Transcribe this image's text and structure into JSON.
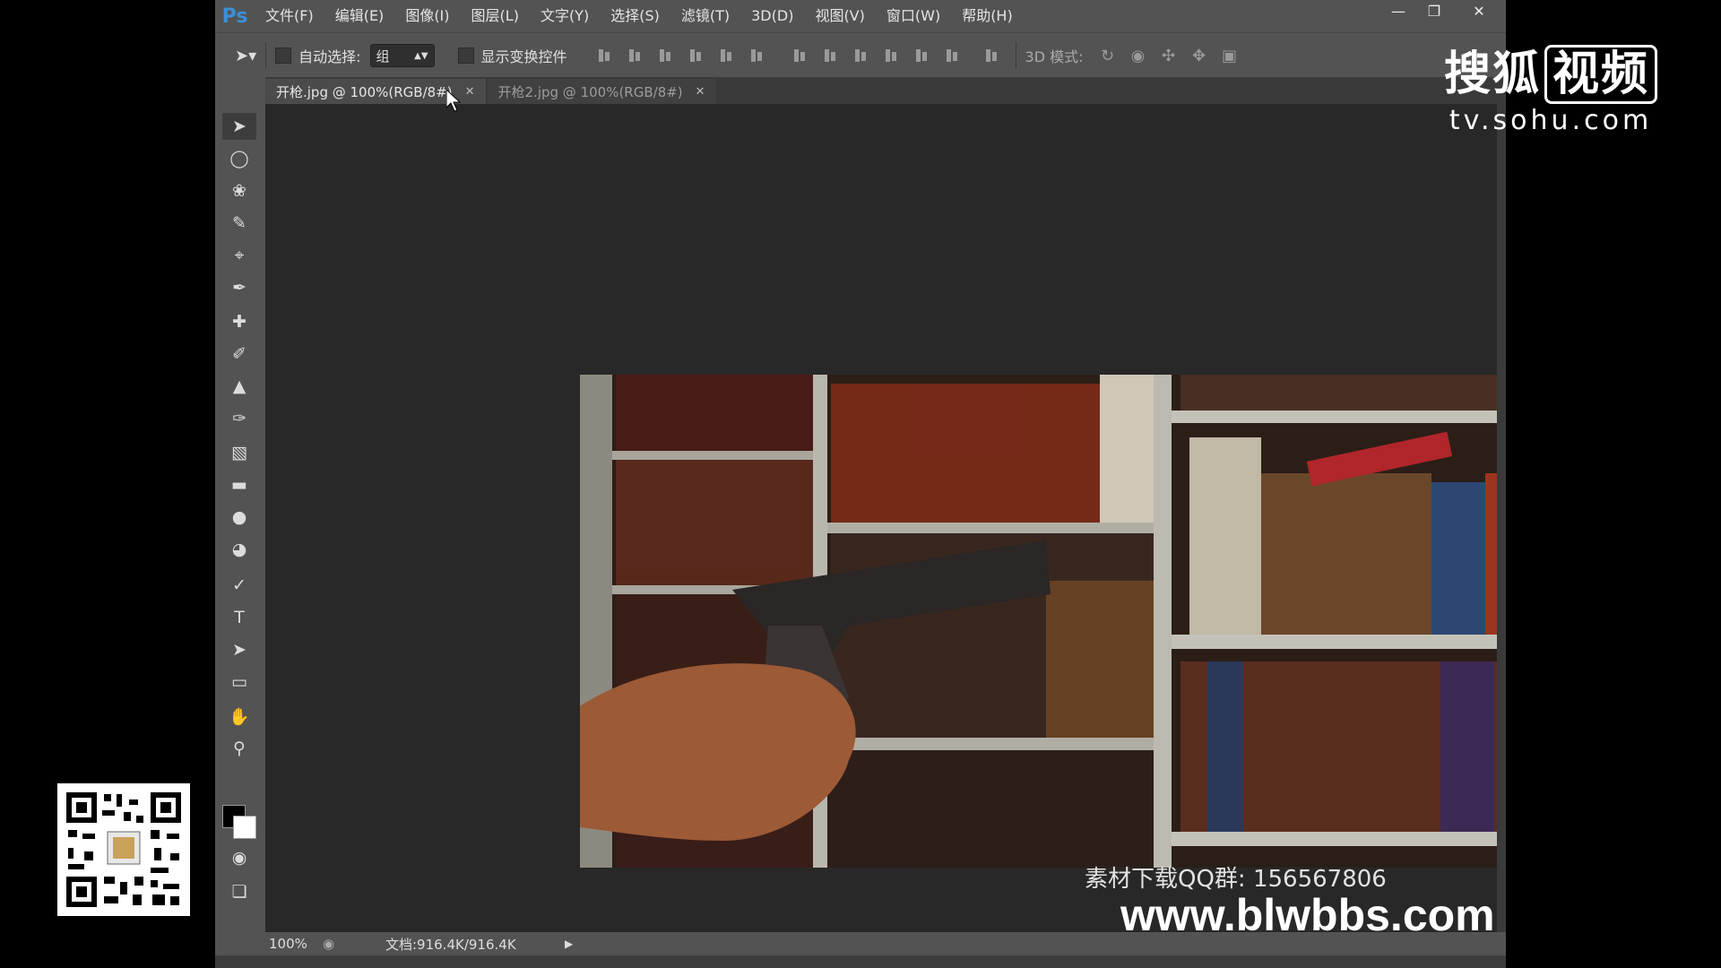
{
  "app": {
    "logo": "Ps",
    "menu": [
      "文件(F)",
      "编辑(E)",
      "图像(I)",
      "图层(L)",
      "文字(Y)",
      "选择(S)",
      "滤镜(T)",
      "3D(D)",
      "视图(V)",
      "窗口(W)",
      "帮助(H)"
    ],
    "window_controls": [
      "minimize-icon",
      "restore-icon",
      "close-icon"
    ]
  },
  "options_bar": {
    "auto_select_label": "自动选择:",
    "auto_select_value": "组",
    "show_transform_label": "显示变换控件",
    "mode_3d_label": "3D 模式:"
  },
  "tabs": [
    {
      "label": "开枪.jpg @ 100%(RGB/8#)",
      "active": true
    },
    {
      "label": "开枪2.jpg @ 100%(RGB/8#)",
      "active": false
    }
  ],
  "tools": [
    "move-tool-icon",
    "marquee-tool-icon",
    "lasso-tool-icon",
    "quick-select-tool-icon",
    "crop-tool-icon",
    "eyedropper-tool-icon",
    "healing-brush-tool-icon",
    "brush-tool-icon",
    "stamp-tool-icon",
    "history-brush-tool-icon",
    "eraser-tool-icon",
    "gradient-tool-icon",
    "blur-tool-icon",
    "dodge-tool-icon",
    "pen-tool-icon",
    "type-tool-icon",
    "path-select-tool-icon",
    "rectangle-tool-icon",
    "hand-tool-icon",
    "zoom-tool-icon"
  ],
  "colors": {
    "foreground": "#000000",
    "background": "#ffffff"
  },
  "status": {
    "zoom": "100%",
    "doc_info": "文档:916.4K/916.4K"
  },
  "overlay": {
    "sohu_name": "搜狐",
    "sohu_name_boxed": "视频",
    "sohu_url": "tv.sohu.com",
    "qq_group": "素材下载QQ群: 156567806",
    "site_url": "www.blwbbs.com"
  }
}
